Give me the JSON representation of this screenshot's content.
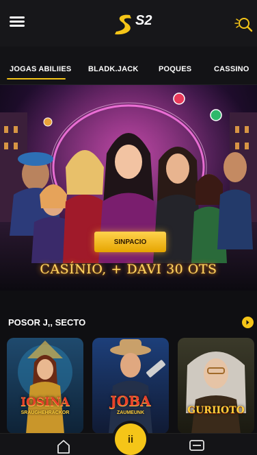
{
  "header": {
    "logo_text": "S2",
    "menu_icon": "hamburger-menu-icon",
    "search_icon": "search-icon",
    "accent": "#f5c518"
  },
  "tabs": [
    {
      "label": "JOGAS ABILIIES",
      "active": true
    },
    {
      "label": "BLADK.JACK",
      "active": false
    },
    {
      "label": "POQUES",
      "active": false
    },
    {
      "label": "CASSINO",
      "active": false
    }
  ],
  "hero": {
    "cta_label": "SINPACIO",
    "promo_text": "CASÍNIO, + DAVI 30 OTS"
  },
  "section": {
    "title": "POSOR J,, SECTO",
    "more_icon": "chevron-right-icon"
  },
  "cards": [
    {
      "title": "IOSINA",
      "subtitle": "SRAUGHEHRACKOR"
    },
    {
      "title": "JOBA",
      "subtitle": "ZAUMEUNK"
    },
    {
      "title": "GURIIOTO",
      "subtitle": ""
    }
  ],
  "bottom_nav": {
    "home_icon": "home-icon",
    "center_label": "ii",
    "wallet_icon": "wallet-icon"
  }
}
